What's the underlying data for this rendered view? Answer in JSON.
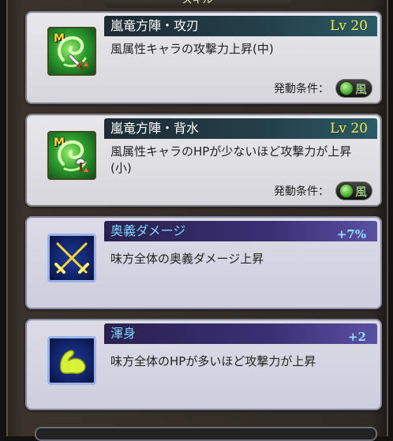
{
  "header": {
    "title": "スキル"
  },
  "cards": [
    {
      "kind": "skill",
      "badge": "M",
      "icon": "wind-swirl-sword-icon",
      "name": "嵐竜方陣・攻刃",
      "level": "Lv 20",
      "description": "風属性キャラの攻撃力上昇(中)",
      "condition_label": "発動条件：",
      "condition_element": "風"
    },
    {
      "kind": "skill",
      "badge": "M",
      "icon": "wind-swirl-axe-icon",
      "name": "嵐竜方陣・背水",
      "level": "Lv 20",
      "description": "風属性キャラのHPが少ないほど攻撃力が上昇(小)",
      "condition_label": "発動条件：",
      "condition_element": "風"
    },
    {
      "kind": "bonus",
      "icon": "crossed-swords-icon",
      "name": "奥義ダメージ",
      "value": "+7%",
      "description": "味方全体の奥義ダメージ上昇"
    },
    {
      "kind": "bonus",
      "icon": "flexed-arm-icon",
      "name": "渾身",
      "value": "+2",
      "description": "味方全体のHPが多いほど攻撃力が上昇"
    }
  ],
  "colors": {
    "skill_bar": "#24404a",
    "bonus_bar": "#3a2f73",
    "level_text": "#f2e84a",
    "bonus_title": "#7fd6ff"
  }
}
